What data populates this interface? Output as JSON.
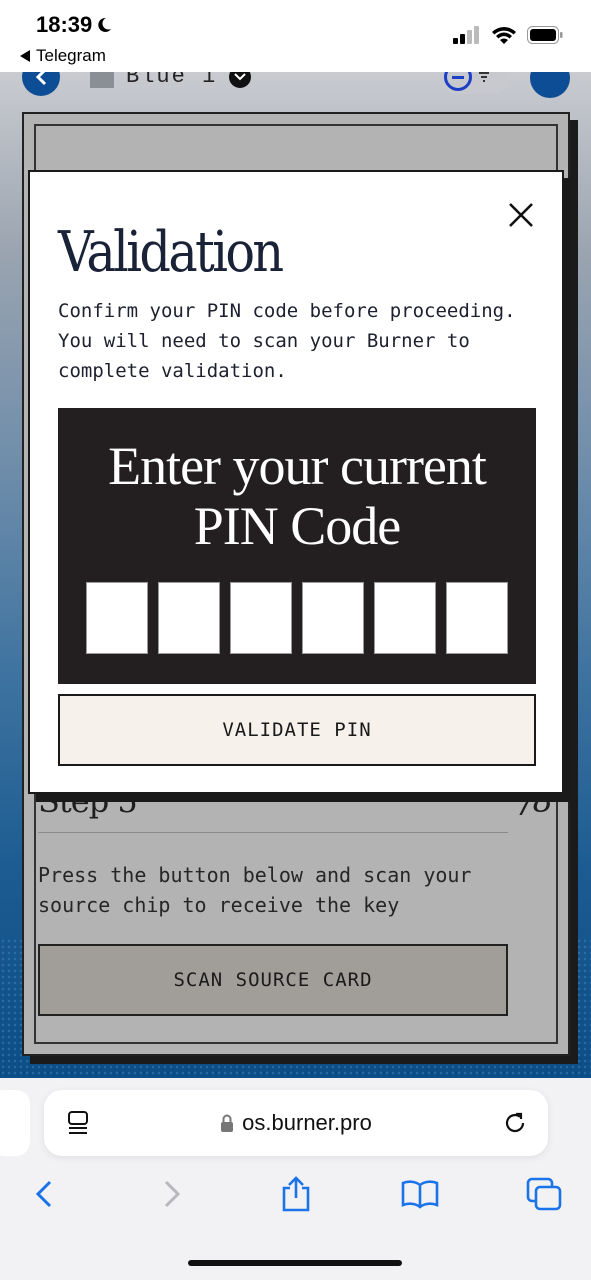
{
  "status_bar": {
    "time": "18:39",
    "back_app": "Telegram"
  },
  "web_header": {
    "wallet_name": "Blue 1"
  },
  "modal": {
    "title": "Validation",
    "description": "Confirm your PIN code before proceeding. You will need to scan your Burner to complete validation.",
    "pin_heading_line1": "Enter your current",
    "pin_heading_line2": "PIN Code",
    "pin_values": [
      "",
      "",
      "",
      "",
      "",
      ""
    ],
    "validate_label": "VALIDATE PIN"
  },
  "background_step": {
    "title": "Step 5",
    "count": "/8",
    "description": "Press the button below and scan your source chip to receive the key",
    "scan_label": "SCAN SOURCE CARD"
  },
  "browser": {
    "url": "os.burner.pro"
  },
  "colors": {
    "accent": "#0d4d95",
    "modal_panel": "#231f20",
    "button_bg": "#f6f1ea"
  }
}
